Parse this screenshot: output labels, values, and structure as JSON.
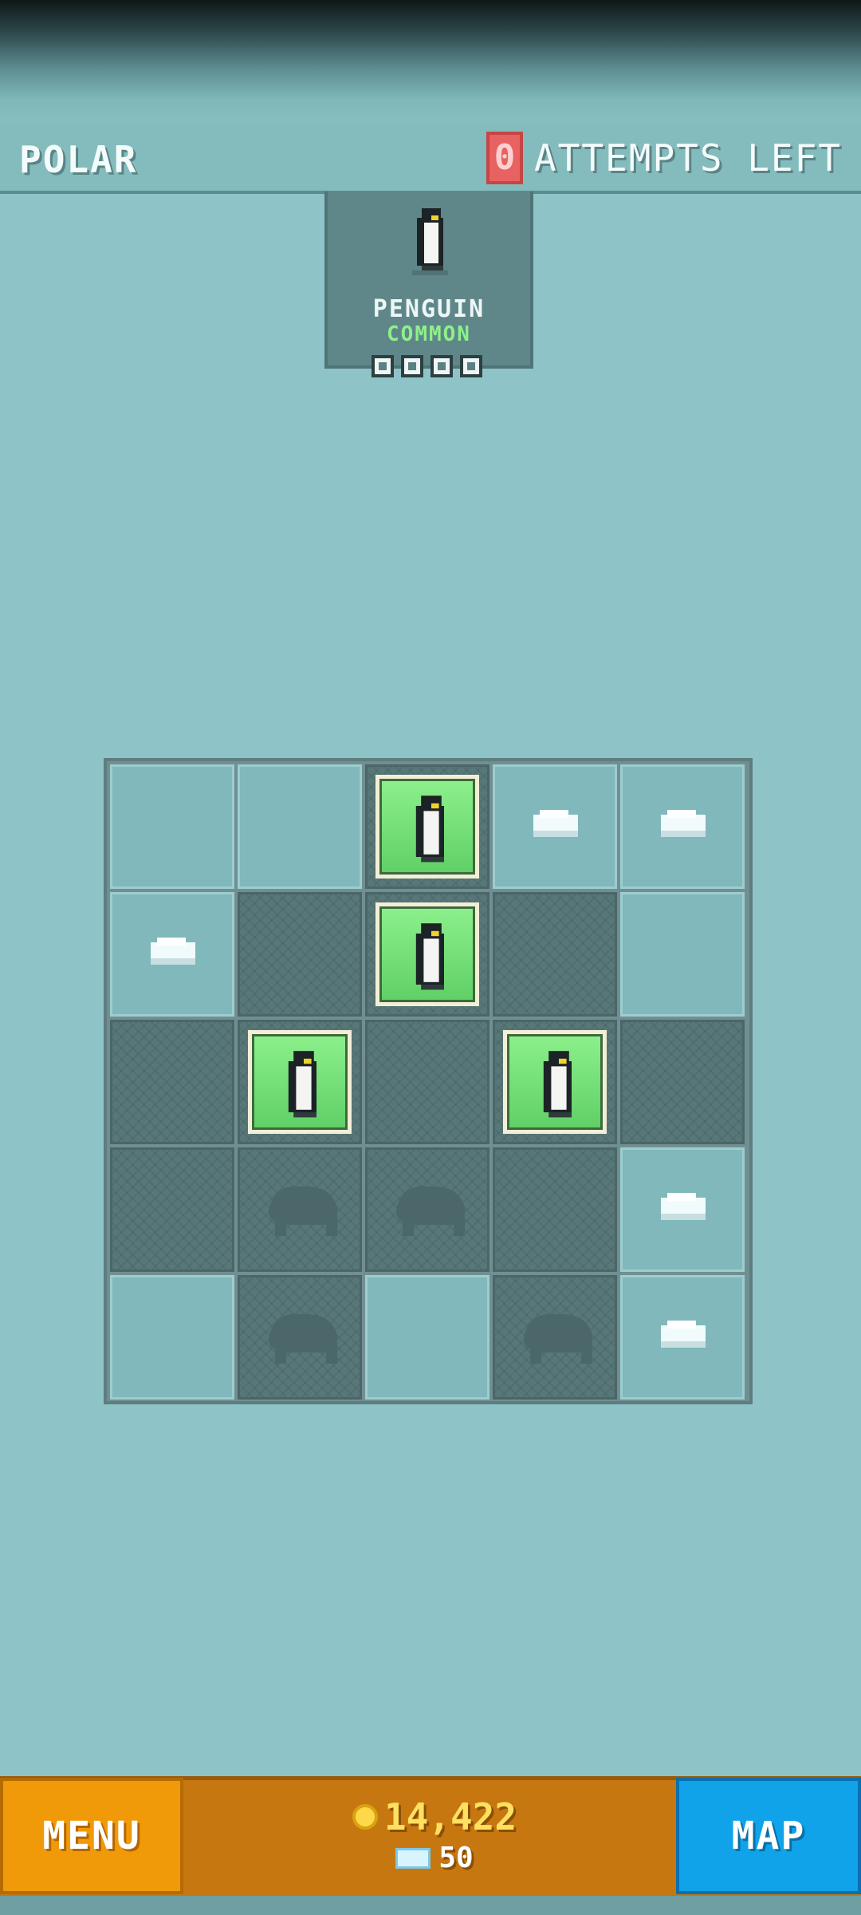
{
  "header": {
    "region": "POLAR",
    "attempts_count": "0",
    "attempts_label": "ATTEMPTS LEFT"
  },
  "target_card": {
    "animal_icon": "penguin-icon",
    "name": "PENGUIN",
    "rarity": "COMMON",
    "progress_total": 4,
    "progress_filled": 0
  },
  "grid": {
    "rows": 5,
    "cols": 5,
    "cells": [
      [
        "light",
        "light",
        "penguin",
        "light-rock",
        "light-rock"
      ],
      [
        "light-rock",
        "dark",
        "penguin",
        "dark",
        "light"
      ],
      [
        "dark",
        "penguin",
        "dark",
        "penguin",
        "dark"
      ],
      [
        "dark",
        "dark-shadow",
        "dark-shadow",
        "dark",
        "light-rock"
      ],
      [
        "light",
        "dark-shadow",
        "light",
        "dark-shadow",
        "light-rock"
      ]
    ]
  },
  "footer": {
    "menu_label": "MENU",
    "map_label": "MAP",
    "coins": "14,422",
    "gems": "50"
  },
  "colors": {
    "background": "#8ec4c8",
    "found_tile": "#7ae27b",
    "menu_button": "#f09a0a",
    "map_button": "#10a3ea",
    "attempts_accent": "#e86262",
    "rarity_common": "#8ef08a"
  }
}
